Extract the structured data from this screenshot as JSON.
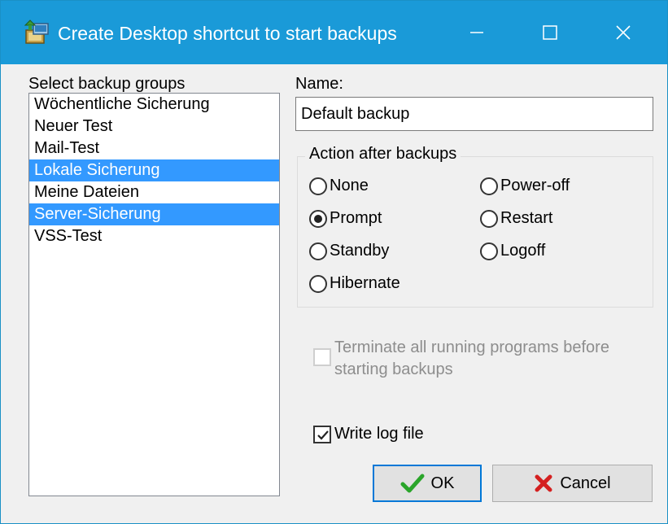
{
  "window": {
    "title": "Create Desktop shortcut to start backups",
    "icon": "backup-app-icon",
    "accent_color": "#1a9ad8",
    "controls": [
      "minimize-icon",
      "maximize-icon",
      "close-icon"
    ]
  },
  "groups": {
    "label": "Select backup groups",
    "items": [
      {
        "label": "Wöchentliche Sicherung",
        "selected": false
      },
      {
        "label": "Neuer Test",
        "selected": false
      },
      {
        "label": "Mail-Test",
        "selected": false
      },
      {
        "label": "Lokale Sicherung",
        "selected": true
      },
      {
        "label": "Meine Dateien",
        "selected": false
      },
      {
        "label": "Server-Sicherung",
        "selected": true
      },
      {
        "label": "VSS-Test",
        "selected": false
      }
    ]
  },
  "name": {
    "label": "Name:",
    "value": "Default backup"
  },
  "action": {
    "legend": "Action after backups",
    "options": {
      "none": "None",
      "prompt": "Prompt",
      "standby": "Standby",
      "hibernate": "Hibernate",
      "poweroff": "Power-off",
      "restart": "Restart",
      "logoff": "Logoff"
    },
    "selected": "Prompt"
  },
  "terminate": {
    "line1": "Terminate all running programs before",
    "line2": "starting backups",
    "checked": false,
    "enabled": false
  },
  "writelog": {
    "label": "Write log file",
    "checked": true
  },
  "buttons": {
    "ok": "OK",
    "ok_icon": "green-check-icon",
    "cancel": "Cancel",
    "cancel_icon": "red-x-icon"
  }
}
